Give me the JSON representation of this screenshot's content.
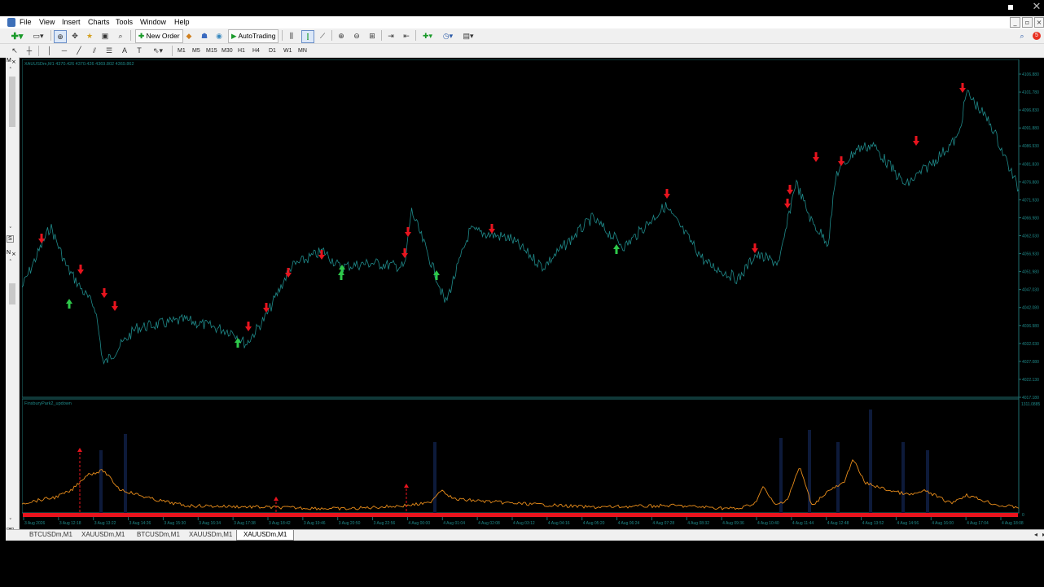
{
  "window": {
    "close_icon": "close-icon"
  },
  "menu": [
    "File",
    "View",
    "Insert",
    "Charts",
    "Tools",
    "Window",
    "Help"
  ],
  "toolbar": {
    "new_order_label": "New Order",
    "autotrading_label": "AutoTrading",
    "notification_count": "5"
  },
  "timeframes": [
    "M1",
    "M5",
    "M15",
    "M30",
    "H1",
    "H4",
    "D1",
    "W1",
    "MN"
  ],
  "left_panel": {
    "top_label": "M",
    "mid_label": "S",
    "second_label": "N",
    "bottom_label": "C"
  },
  "chart": {
    "header": "XAUUSDm,M1  4370.426 4370.426 4369.802 4369.862",
    "indicator_header": "FinsburyPark2_updown",
    "indicator_axis_top": "1311.0885",
    "indicator_axis_bottom": "0",
    "price_ticks": [
      "4106.880",
      "4101.780",
      "4096.830",
      "4091.880",
      "4086.930",
      "4081.830",
      "4076.880",
      "4071.930",
      "4066.980",
      "4062.030",
      "4056.930",
      "4051.980",
      "4047.030",
      "4042.080",
      "4036.980",
      "4032.030",
      "4027.080",
      "4022.130",
      "4017.180"
    ],
    "time_ticks": [
      "3 Aug 2026",
      "3 Aug 12:18",
      "3 Aug 13:22",
      "3 Aug 14:26",
      "3 Aug 15:30",
      "3 Aug 16:34",
      "3 Aug 17:38",
      "3 Aug 18:42",
      "3 Aug 19:46",
      "3 Aug 20:50",
      "3 Aug 22:56",
      "4 Aug 00:00",
      "4 Aug 01:04",
      "4 Aug 02:08",
      "4 Aug 03:12",
      "4 Aug 04:16",
      "4 Aug 05:20",
      "4 Aug 06:24",
      "4 Aug 07:28",
      "4 Aug 08:32",
      "4 Aug 09:36",
      "4 Aug 10:40",
      "4 Aug 11:44",
      "4 Aug 12:48",
      "4 Aug 13:52",
      "4 Aug 14:56",
      "4 Aug 16:00",
      "4 Aug 17:04",
      "4 Aug 18:08"
    ],
    "colors": {
      "price_line": "#1f8a8a",
      "up_arrow": "#2ec84a",
      "down_arrow": "#e8141e",
      "indicator_line": "#e88c1a",
      "indicator_bar": "#e8141e",
      "axis_text": "#1f8a8a",
      "border": "#1f6f6f"
    }
  },
  "tabs": [
    "BTCUSDm,M1",
    "XAUUSDm,M1",
    "BTCUSDm,M1",
    "XAUUSDm,M1",
    "XAUUSDm,M1"
  ],
  "active_tab": 4
}
